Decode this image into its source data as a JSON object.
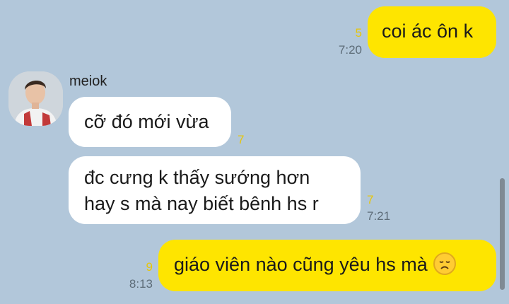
{
  "messages": [
    {
      "id": "m1",
      "direction": "outgoing",
      "text": "coi ác ôn k",
      "unread": "5",
      "time": "7:20"
    },
    {
      "id": "m2",
      "direction": "incoming",
      "sender": "meiok",
      "text": "cỡ đó mới vừa",
      "unread": "7"
    },
    {
      "id": "m3",
      "direction": "incoming",
      "text": [
        "đc cưng k thấy sướng hơn",
        "hay s mà nay biết bênh hs r"
      ],
      "unread": "7",
      "time": "7:21"
    },
    {
      "id": "m4",
      "direction": "outgoing",
      "text": "giáo viên nào cũng yêu hs mà",
      "emoji": "disappointed-face",
      "unread": "9",
      "time": "8:13"
    }
  ],
  "colors": {
    "background": "#b2c7da",
    "outgoing_bubble": "#fee500",
    "incoming_bubble": "#ffffff",
    "unread_count": "#e6c60c",
    "timestamp": "#5d6c78"
  }
}
